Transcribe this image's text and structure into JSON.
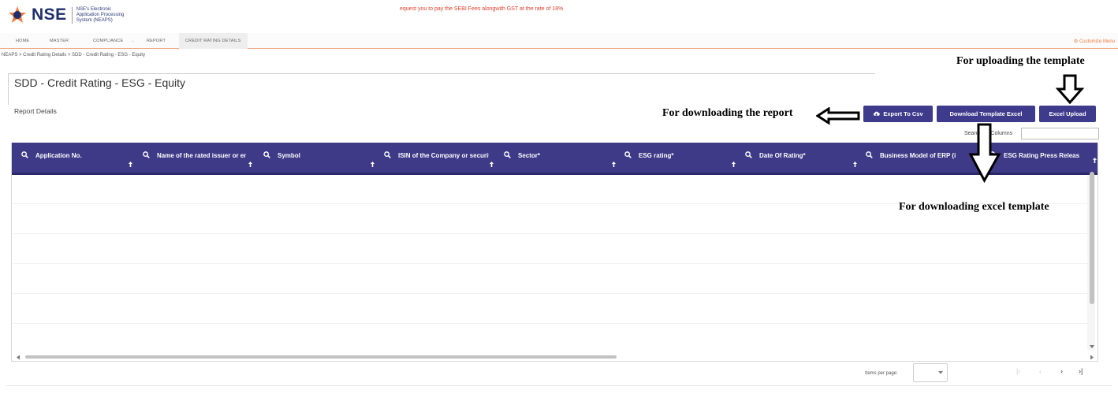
{
  "header": {
    "logo_text": "NSE",
    "logo_subtitle": "NSE's Electronic Application Processing System (NEAPS)",
    "marquee": "equest you to pay the SEBI Fees alongwith GST at the rate of 18%"
  },
  "nav": {
    "items": [
      "HOME",
      "MASTER",
      "COMPLIANCE",
      "REPORT",
      "CREDIT RATING DETAILS"
    ],
    "active": "CREDIT RATING DETAILS",
    "customize": "Customize Menu"
  },
  "breadcrumb": "NEAPS > Credit Rating Details > SDD - Credit Rating - ESG - Equity",
  "page": {
    "title": "SDD - Credit Rating - ESG - Equity",
    "section": "Report Details"
  },
  "toolbar": {
    "export_csv": "Export To Csv",
    "download_template": "Download Template Excel",
    "excel_upload": "Excel Upload"
  },
  "search": {
    "label": "Search All Columns",
    "value": ""
  },
  "table": {
    "columns": [
      "Application No.",
      "Name of the rated issuer or entity",
      "Symbol",
      "ISIN of the Company or security",
      "Sector*",
      "ESG rating*",
      "Date Of Rating*",
      "Business Model of ERP (i",
      "ESG Rating Press Releas"
    ],
    "rows": []
  },
  "paginator": {
    "items_per_page_label": "Items per page:",
    "items_per_page_value": ""
  },
  "annotations": {
    "upload": "For uploading the template",
    "report": "For downloading the report",
    "excel": "For downloading excel template"
  },
  "colors": {
    "header_bg": "#3f3a87",
    "button_bg": "#3e3a8c",
    "marquee": "#e0402e",
    "accent": "#f07a3c"
  }
}
